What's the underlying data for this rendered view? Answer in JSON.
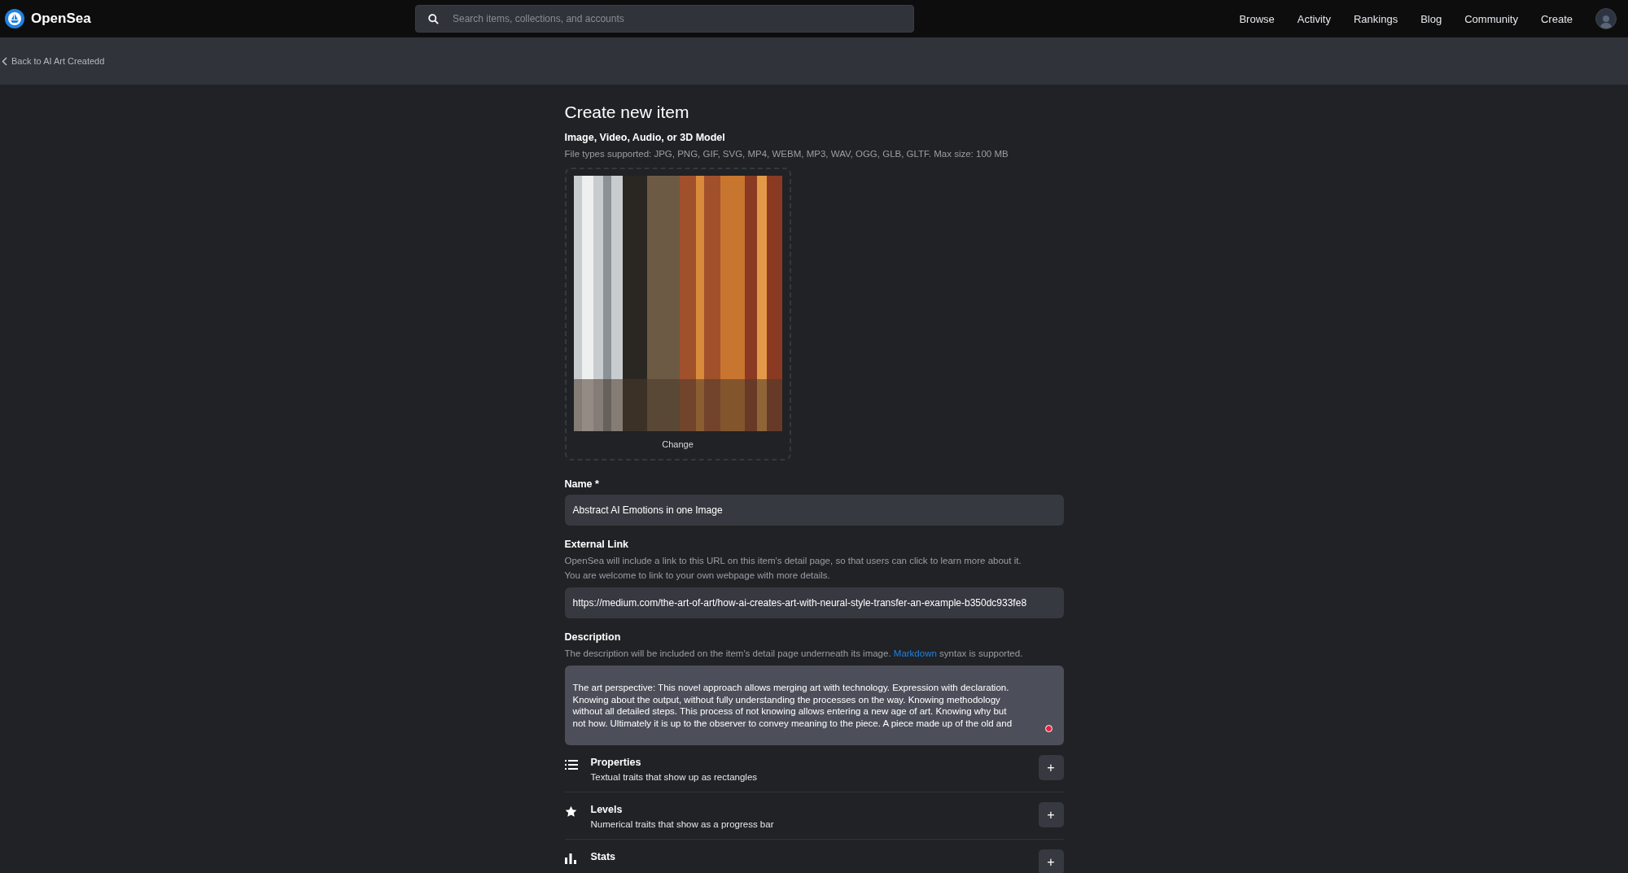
{
  "header": {
    "brand": "OpenSea",
    "search": {
      "placeholder": "Search items, collections, and accounts"
    },
    "nav": [
      "Browse",
      "Activity",
      "Rankings",
      "Blog",
      "Community",
      "Create"
    ]
  },
  "back_link": "Back to AI Art Createdd",
  "form": {
    "title": "Create new item",
    "media": {
      "label": "Image, Video, Audio, or 3D Model",
      "hint": "File types supported: JPG, PNG, GIF, SVG, MP4, WEBM, MP3, WAV, OGG, GLB, GLTF. Max size: 100 MB",
      "change": "Change"
    },
    "name": {
      "label": "Name *",
      "value": "Abstract AI Emotions in one Image"
    },
    "external_link": {
      "label": "External Link",
      "hint_lines": [
        "OpenSea will include a link to this URL on this item's detail page, so that users can click to learn more about it.",
        "You are welcome to link to your own webpage with more details."
      ],
      "value": "https://medium.com/the-art-of-art/how-ai-creates-art-with-neural-style-transfer-an-example-b350dc933fe8"
    },
    "description": {
      "label": "Description",
      "hint_before": "The description will be included on the item's detail page underneath its image.",
      "hint_link": "Markdown",
      "hint_after": "syntax is supported.",
      "value_lines": [
        "The art perspective: This novel approach allows merging art with technology. Expression with declaration.",
        "Knowing about the output, without fully understanding the processes on the way. Knowing methodology",
        "without all detailed steps. This process of not knowing allows entering a new age of art. Knowing why but",
        "not how. Ultimately it is up to the observer to convey meaning to the piece. A piece made up of the old and"
      ]
    },
    "traits": [
      {
        "kind": "list",
        "title": "Properties",
        "subtitle": "Textual traits that show up as rectangles",
        "button": "+"
      },
      {
        "kind": "star",
        "title": "Levels",
        "subtitle": "Numerical traits that show as a progress bar",
        "button": "+"
      },
      {
        "kind": "bars",
        "title": "Stats",
        "button": "+"
      }
    ]
  }
}
